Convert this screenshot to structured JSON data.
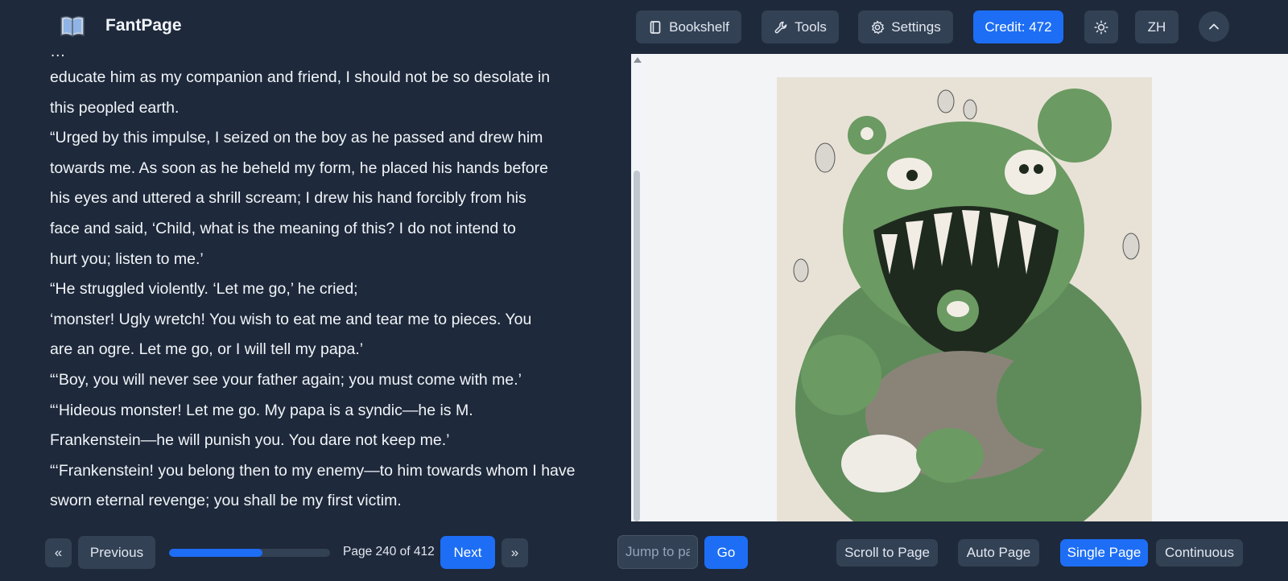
{
  "header": {
    "brand": "FantPage",
    "bookshelf_label": "Bookshelf",
    "tools_label": "Tools",
    "settings_label": "Settings",
    "credit_label": "Credit: 472",
    "language_label": "ZH"
  },
  "reader": {
    "lines": [
      "educate him as my companion and friend, I should not be so desolate in",
      "this peopled earth.",
      "“Urged by this impulse, I seized on the boy as he passed and drew him",
      "towards me. As soon as he beheld my form, he placed his hands before",
      "his eyes and uttered a shrill scream; I drew his hand forcibly from his",
      "face and said, ‘Child, what is the meaning of this? I do not intend to",
      "hurt you; listen to me.’",
      "“He struggled violently. ‘Let me go,’ he cried;",
      "‘monster! Ugly wretch! You wish to eat me and tear me to pieces. You",
      "are an ogre. Let me go, or I will tell my papa.’",
      "“‘Boy, you will never see your father again; you must come with me.’",
      "“‘Hideous monster! Let me go. My papa is a syndic—he is M.",
      "Frankenstein—he will punish you. You dare not keep me.’",
      "“‘Frankenstein! you belong then to my enemy—to him towards whom I have",
      "sworn eternal revenge; you shall be my first victim."
    ]
  },
  "footer": {
    "first_label": "«",
    "previous_label": "Previous",
    "progress_fraction": 0.58,
    "page_text": "Page 240 of 412",
    "next_label": "Next",
    "last_label": "»",
    "jump_placeholder": "Jump to page",
    "go_label": "Go",
    "scroll_to_page_label": "Scroll to Page",
    "auto_page_label": "Auto Page",
    "single_page_label": "Single Page",
    "continuous_label": "Continuous"
  },
  "colors": {
    "background": "#1e293b",
    "button": "#334155",
    "accent": "#1d6ef5"
  },
  "icons": {
    "logo": "book-open-icon",
    "bookshelf": "book-icon",
    "tools": "wrench-icon",
    "settings": "gear-icon",
    "theme": "sun-icon",
    "collapse": "chevron-up-icon"
  }
}
